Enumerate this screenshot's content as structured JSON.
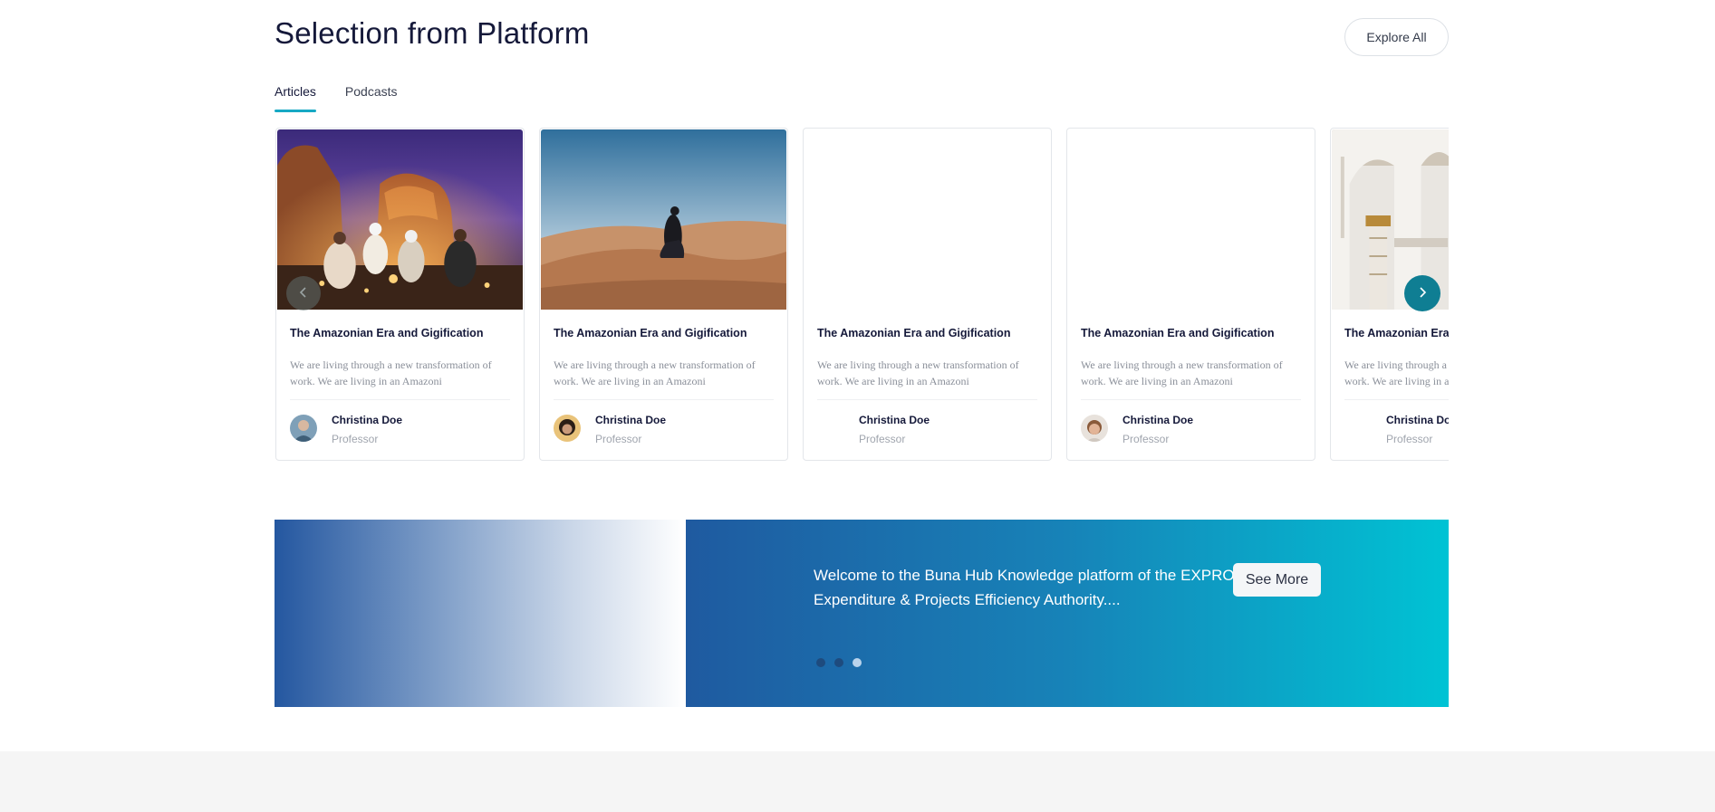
{
  "section": {
    "title": "Selection from Platform",
    "explore_label": "Explore All"
  },
  "tabs": [
    {
      "label": "Articles",
      "active": true
    },
    {
      "label": "Podcasts",
      "active": false
    }
  ],
  "cards": [
    {
      "title": "The Amazonian Era and Gigification",
      "description": "We are living through a new transformation of work. We are living in an Amazoni",
      "author": "Christina Doe",
      "role": "Professor",
      "image": "desert-camp-night",
      "avatar": "avatar-woman"
    },
    {
      "title": "The Amazonian Era and Gigification",
      "description": "We are living through a new transformation of work. We are living in an Amazoni",
      "author": "Christina Doe",
      "role": "Professor",
      "image": "desert-dunes-woman",
      "avatar": "avatar-man-dark"
    },
    {
      "title": "The Amazonian Era and Gigification",
      "description": "We are living through a new transformation of work. We are living in an Amazoni",
      "author": "Christina Doe",
      "role": "Professor",
      "image": "blank",
      "avatar": "none"
    },
    {
      "title": "The Amazonian Era and Gigification",
      "description": "We are living through a new transformation of work. We are living in an Amazoni",
      "author": "Christina Doe",
      "role": "Professor",
      "image": "blank",
      "avatar": "avatar-man-light"
    },
    {
      "title": "The Amazonian Era and Gigification",
      "description": "We are living through a new transformation of work. We are living in an Amazoni",
      "author": "Christina Doe",
      "role": "Professor",
      "image": "mosque-arches",
      "avatar": "none"
    }
  ],
  "carousel_nav": {
    "prev_icon": "chevron-left-icon",
    "next_icon": "chevron-right-icon"
  },
  "banner": {
    "text": "Welcome to the Buna Hub Knowledge platform of the EXPRO, Expenditure & Projects Efficiency Authority....",
    "button_label": "See More",
    "dots_count": 3,
    "active_dot": 3
  },
  "colors": {
    "accent": "#17a9c4",
    "nav_next": "#0f7e93",
    "banner_start": "#1f5aa0",
    "banner_end": "#00c3d4",
    "heading": "#15193a"
  }
}
